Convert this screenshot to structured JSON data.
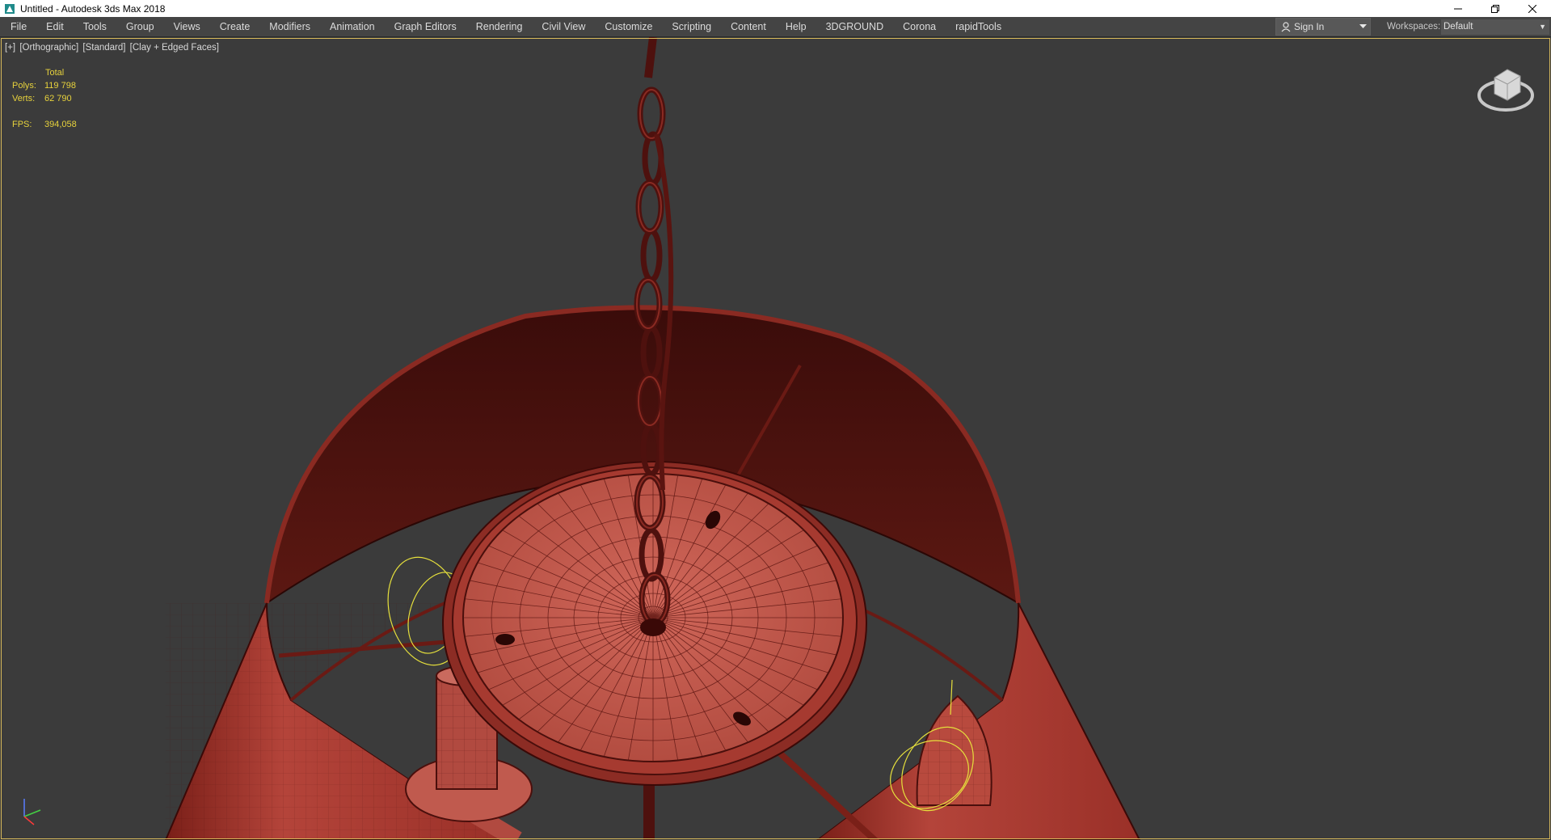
{
  "window": {
    "title": "Untitled - Autodesk 3ds Max 2018"
  },
  "menu": {
    "items": [
      "File",
      "Edit",
      "Tools",
      "Group",
      "Views",
      "Create",
      "Modifiers",
      "Animation",
      "Graph Editors",
      "Rendering",
      "Civil View",
      "Customize",
      "Scripting",
      "Content",
      "Help",
      "3DGROUND",
      "Corona",
      "rapidTools"
    ]
  },
  "account": {
    "sign_in_label": "Sign In"
  },
  "workspaces": {
    "label": "Workspaces:",
    "value": "Default"
  },
  "viewport": {
    "label_plus": "[+]",
    "label_view": "[Orthographic]",
    "label_shading_std": "[Standard]",
    "label_shading_mode": "[Clay + Edged Faces]"
  },
  "stats": {
    "header": "Total",
    "polys_label": "Polys:",
    "polys_value": "119 798",
    "verts_label": "Verts:",
    "verts_value": "62 790",
    "fps_label": "FPS:",
    "fps_value": "394,058"
  },
  "colors": {
    "viewport_bg": "#3b3b3b",
    "clay_red": "#b8443a",
    "clay_dark": "#5a1410",
    "stats_yellow": "#e7d23c",
    "menubar_bg": "#444444"
  },
  "icons": [
    "app-icon",
    "minimize-icon",
    "restore-icon",
    "close-icon",
    "user-icon",
    "dropdown-icon",
    "viewcube-icon",
    "axis-tripod-icon"
  ]
}
